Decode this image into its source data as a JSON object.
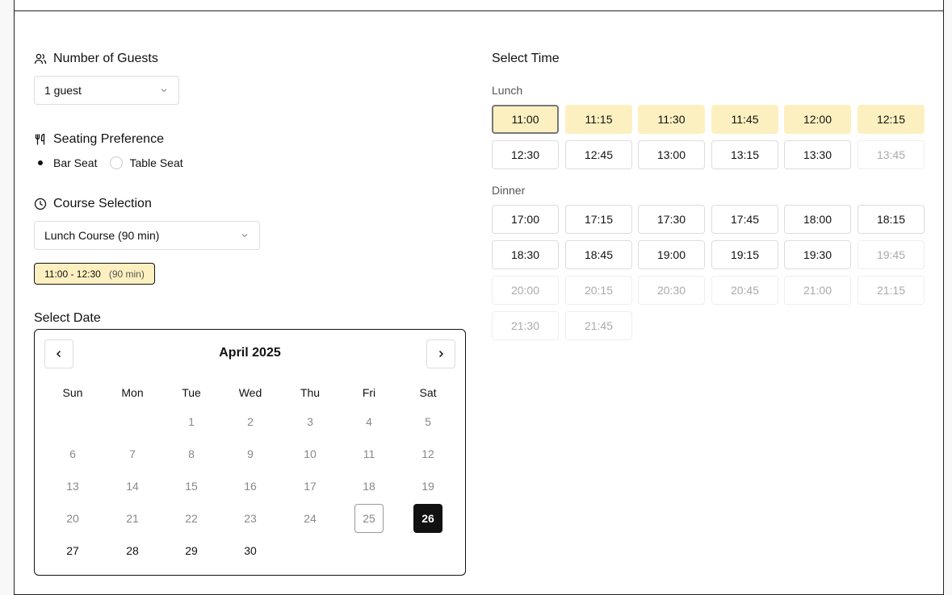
{
  "guests": {
    "title": "Number of Guests",
    "value": "1 guest"
  },
  "seating": {
    "title": "Seating Preference",
    "options": [
      "Bar Seat",
      "Table Seat"
    ],
    "selected": "Bar Seat"
  },
  "course": {
    "title": "Course Selection",
    "value": "Lunch Course (90 min)",
    "time_range": "11:00 - 12:30",
    "duration": "(90 min)"
  },
  "date": {
    "title": "Select Date",
    "month": "April 2025",
    "weekdays": [
      "Sun",
      "Mon",
      "Tue",
      "Wed",
      "Thu",
      "Fri",
      "Sat"
    ],
    "days": [
      "1",
      "2",
      "3",
      "4",
      "5",
      "6",
      "7",
      "8",
      "9",
      "10",
      "11",
      "12",
      "13",
      "14",
      "15",
      "16",
      "17",
      "18",
      "19",
      "20",
      "21",
      "22",
      "23",
      "24",
      "25",
      "26",
      "27",
      "28",
      "29",
      "30"
    ],
    "today": "25",
    "selected": "26"
  },
  "time": {
    "title": "Select Time",
    "lunch_label": "Lunch",
    "dinner_label": "Dinner",
    "lunch": [
      {
        "t": "11:00",
        "state": "sel"
      },
      {
        "t": "11:15",
        "state": "hl"
      },
      {
        "t": "11:30",
        "state": "hl"
      },
      {
        "t": "11:45",
        "state": "hl"
      },
      {
        "t": "12:00",
        "state": "hl"
      },
      {
        "t": "12:15",
        "state": "hl"
      },
      {
        "t": "12:30",
        "state": "avail"
      },
      {
        "t": "12:45",
        "state": "avail"
      },
      {
        "t": "13:00",
        "state": "avail"
      },
      {
        "t": "13:15",
        "state": "avail"
      },
      {
        "t": "13:30",
        "state": "avail"
      },
      {
        "t": "13:45",
        "state": "dis"
      }
    ],
    "dinner": [
      {
        "t": "17:00",
        "state": "avail"
      },
      {
        "t": "17:15",
        "state": "avail"
      },
      {
        "t": "17:30",
        "state": "avail"
      },
      {
        "t": "17:45",
        "state": "avail"
      },
      {
        "t": "18:00",
        "state": "avail"
      },
      {
        "t": "18:15",
        "state": "avail"
      },
      {
        "t": "18:30",
        "state": "avail"
      },
      {
        "t": "18:45",
        "state": "avail"
      },
      {
        "t": "19:00",
        "state": "avail"
      },
      {
        "t": "19:15",
        "state": "avail"
      },
      {
        "t": "19:30",
        "state": "avail"
      },
      {
        "t": "19:45",
        "state": "dis"
      },
      {
        "t": "20:00",
        "state": "dis"
      },
      {
        "t": "20:15",
        "state": "dis"
      },
      {
        "t": "20:30",
        "state": "dis"
      },
      {
        "t": "20:45",
        "state": "dis"
      },
      {
        "t": "21:00",
        "state": "dis"
      },
      {
        "t": "21:15",
        "state": "dis"
      },
      {
        "t": "21:30",
        "state": "dis"
      },
      {
        "t": "21:45",
        "state": "dis"
      }
    ]
  },
  "colors": {
    "highlight": "#fdf0c0",
    "selected_day": "#111111"
  }
}
